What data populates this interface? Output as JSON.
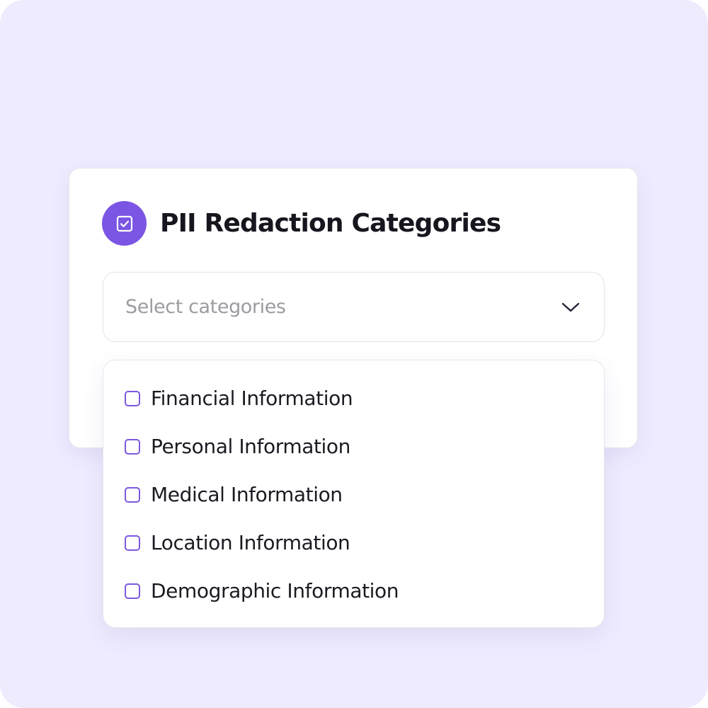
{
  "colors": {
    "background": "#efebfe",
    "accent": "#7b55e3",
    "checkbox_border": "#7d58df",
    "title_text": "#17161e",
    "placeholder_text": "#9c9ba1"
  },
  "header": {
    "icon": "checkbox-icon",
    "title": "PII Redaction Categories"
  },
  "select": {
    "placeholder": "Select categories",
    "icon": "chevron-down-icon"
  },
  "options": [
    {
      "label": "Financial Information",
      "checked": false
    },
    {
      "label": "Personal Information",
      "checked": false
    },
    {
      "label": "Medical Information",
      "checked": false
    },
    {
      "label": "Location Information",
      "checked": false
    },
    {
      "label": "Demographic Information",
      "checked": false
    }
  ]
}
